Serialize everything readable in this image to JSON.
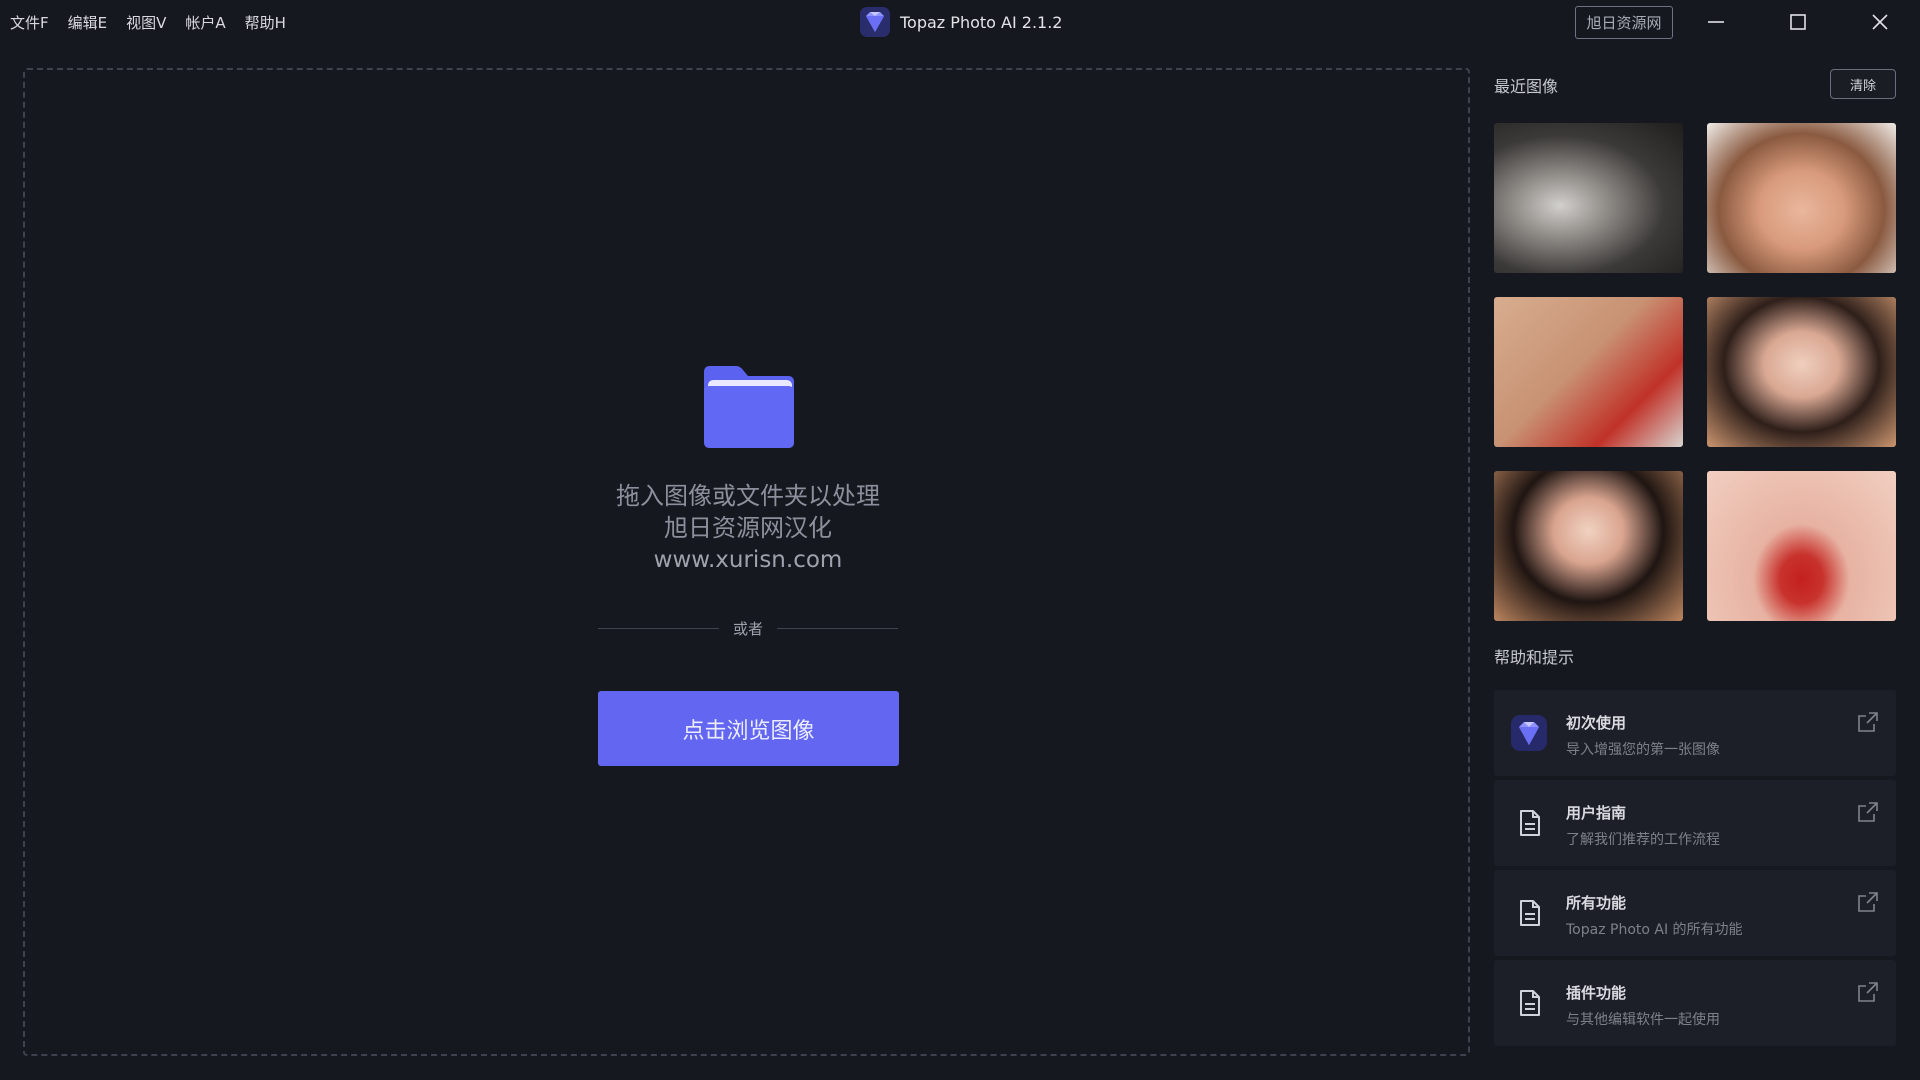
{
  "menu": {
    "file": "文件F",
    "edit": "编辑E",
    "view": "视图V",
    "account": "帐户A",
    "help": "帮助H"
  },
  "app": {
    "title": "Topaz Photo AI 2.1.2",
    "site_badge": "旭日资源网"
  },
  "dropzone": {
    "line1": "拖入图像或文件夹以处理",
    "line2": "旭日资源网汉化",
    "line3": "www.xurisn.com",
    "or_text": "或者",
    "browse_label": "点击浏览图像"
  },
  "recent": {
    "title": "最近图像",
    "clear_label": "清除"
  },
  "help": {
    "title": "帮助和提示",
    "items": [
      {
        "title": "初次使用",
        "subtitle": "导入增强您的第一张图像",
        "icon": "topaz-logo-icon"
      },
      {
        "title": "用户指南",
        "subtitle": "了解我们推荐的工作流程",
        "icon": "document-icon"
      },
      {
        "title": "所有功能",
        "subtitle": "Topaz Photo AI 的所有功能",
        "icon": "document-icon"
      },
      {
        "title": "插件功能",
        "subtitle": "与其他编辑软件一起使用",
        "icon": "document-icon"
      }
    ]
  },
  "colors": {
    "background": "#16181f",
    "accent": "#6366f0",
    "folder": "#5b62f0",
    "card": "#1d1f28"
  }
}
